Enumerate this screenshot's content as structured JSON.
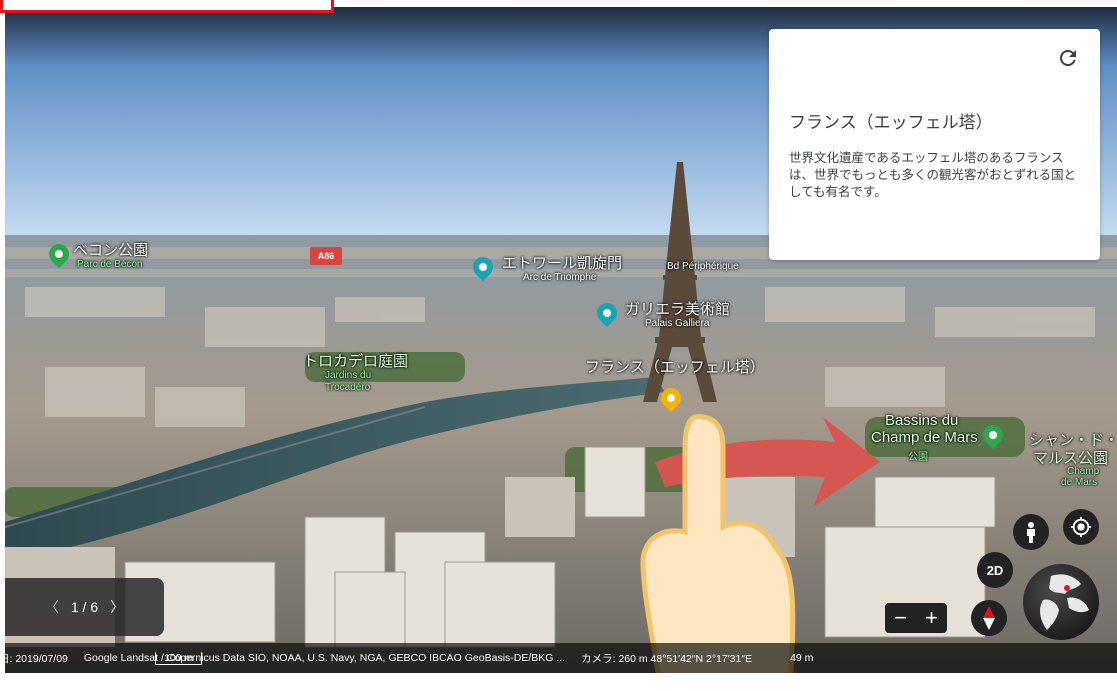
{
  "info_card": {
    "title": "フランス（エッフェル塔）",
    "body": "世界文化遺産であるエッフェル塔のあるフランスは、世界でもっとも多くの観光客がおとずれる国としても有名です。",
    "refresh_icon": "refresh-icon"
  },
  "map_labels": {
    "becon_park": "ベコン公園",
    "becon_park_fr": "Parc de Bécon",
    "road_a86": "A86",
    "arc": "エトワール凱旋門",
    "arc_fr": "Arc de Triomphe",
    "bd_periph": "Bd Périphérique",
    "galliera": "ガリエラ美術館",
    "galliera_fr": "Palais Galliera",
    "trocadero": "トロカデロ庭園",
    "trocadero_fr_1": "Jardins du",
    "trocadero_fr_2": "Trocadéro",
    "eiffel": "フランス（エッフェル塔）",
    "bassins_1": "Bassins du",
    "bassins_2": "Champ de Mars",
    "bassins_sub": "公園",
    "champ_1": "シャン・ド・",
    "champ_2": "マルス公園",
    "champ_fr_1": "Champ",
    "champ_fr_2": "de Mars"
  },
  "tour": {
    "prev": "〈",
    "counter": "1 / 6",
    "next": "〉"
  },
  "bottom_bar": {
    "date": "日: 2019/07/09",
    "credits": "Google  Landsat / Copernicus  Data SIO, NOAA, U.S. Navy, NGA, GEBCO  IBCAO  GeoBasis-DE/BKG ...",
    "scale": "100 m",
    "camera": "カメラ: 260 m   48°51′42″N 2°17′31″E",
    "altitude": "49 m"
  },
  "controls": {
    "mode_2d": "2D",
    "zoom_out": "−",
    "zoom_in": "+",
    "pegman_icon": "pegman-icon",
    "location_icon": "my-location-icon",
    "compass_icon": "compass-icon",
    "globe_icon": "globe-icon"
  },
  "colors": {
    "accent_red": "#e4141b",
    "arrow": "#d9534f",
    "hand": "#fde6c0",
    "pin_green": "#2aa84a",
    "pin_teal": "#1aa3b0",
    "pin_yellow": "#f2b400"
  }
}
